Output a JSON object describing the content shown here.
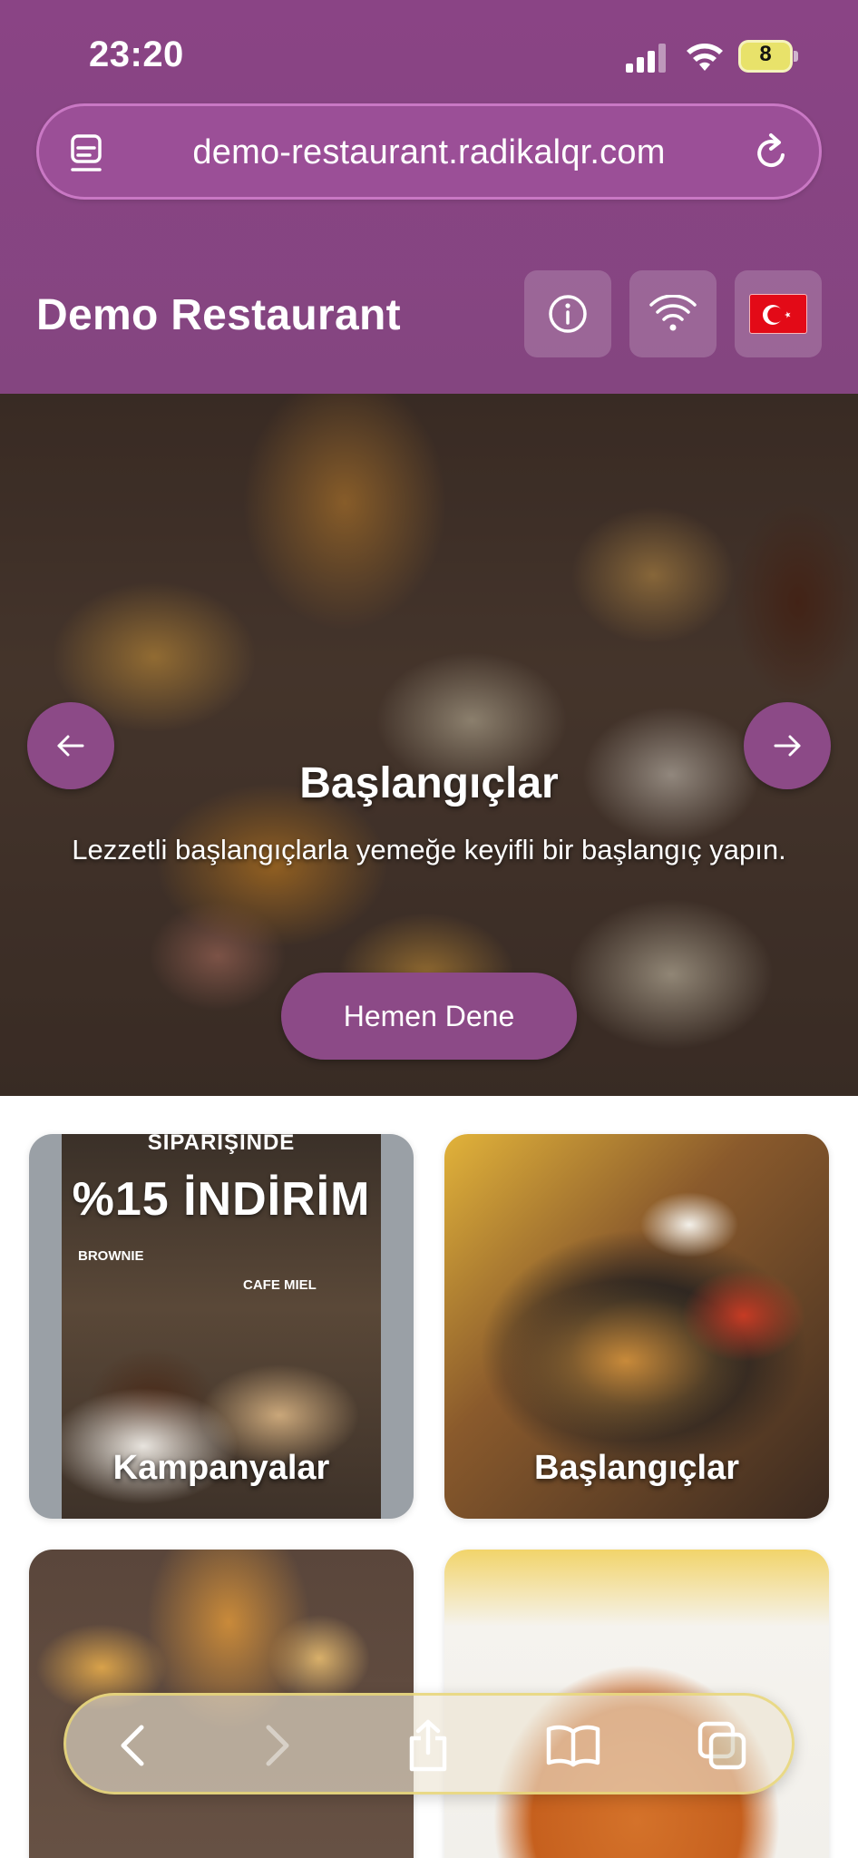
{
  "status_bar": {
    "time": "23:20",
    "battery": "8",
    "icons": [
      "signal-icon",
      "wifi-icon",
      "battery-icon"
    ]
  },
  "browser": {
    "url": "demo-restaurant.radikalqr.com",
    "icons": [
      "tabs-icon",
      "reload-icon"
    ]
  },
  "header": {
    "title": "Demo Restaurant",
    "buttons": [
      "info-icon",
      "wifi-icon",
      "turkey-flag-icon"
    ]
  },
  "hero": {
    "title": "Başlangıçlar",
    "subtitle": "Lezzetli başlangıçlarla yemeğe keyifli bir başlangıç yapın.",
    "cta": "Hemen Dene",
    "icons": [
      "arrow-left-icon",
      "arrow-right-icon"
    ]
  },
  "categories": [
    {
      "label": "Kampanyalar",
      "promo": {
        "top": "SİPARİŞİNDE",
        "headline": "%15 İNDİRİM",
        "item_left": "BROWNIE",
        "item_right": "CAFE MIEL"
      }
    },
    {
      "label": "Başlangıçlar"
    },
    {
      "label": ""
    },
    {
      "label": ""
    }
  ],
  "toolbar": {
    "icons": [
      "back-icon",
      "forward-icon",
      "share-icon",
      "bookmarks-icon",
      "tabs-overview-icon"
    ]
  },
  "colors": {
    "brand_purple": "#8a4485",
    "button_purple": "#8c4a87",
    "url_bar": "#9b4f97"
  }
}
